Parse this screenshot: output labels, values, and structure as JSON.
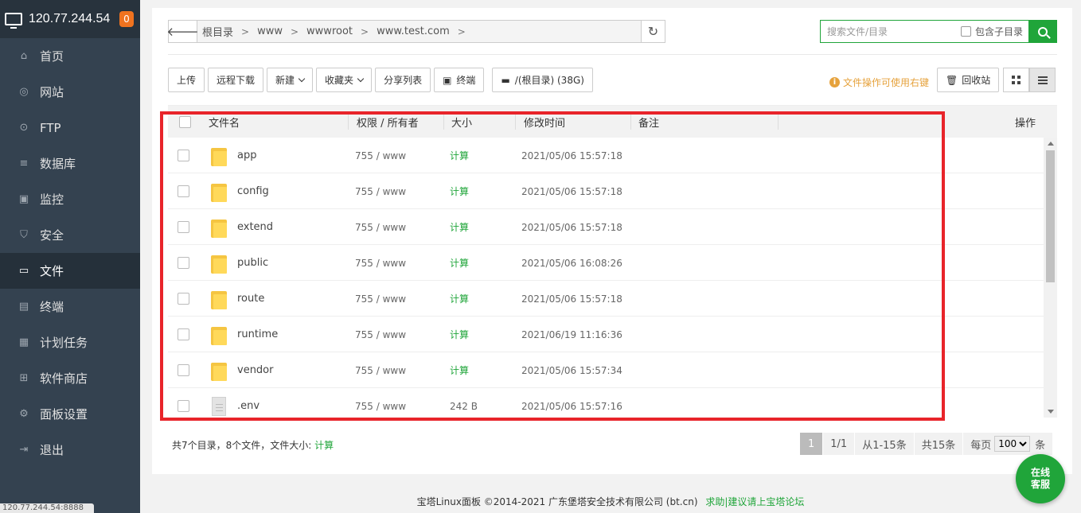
{
  "sidebar": {
    "server_ip": "120.77.244.54",
    "badge_count": "0",
    "items": [
      {
        "label": "首页",
        "icon": "home-icon"
      },
      {
        "label": "网站",
        "icon": "globe-icon"
      },
      {
        "label": "FTP",
        "icon": "ftp-icon"
      },
      {
        "label": "数据库",
        "icon": "database-icon"
      },
      {
        "label": "监控",
        "icon": "monitor-icon"
      },
      {
        "label": "安全",
        "icon": "shield-icon"
      },
      {
        "label": "文件",
        "icon": "folder-icon",
        "active": true
      },
      {
        "label": "终端",
        "icon": "terminal-icon"
      },
      {
        "label": "计划任务",
        "icon": "calendar-icon"
      },
      {
        "label": "软件商店",
        "icon": "apps-icon"
      },
      {
        "label": "面板设置",
        "icon": "gear-icon"
      },
      {
        "label": "退出",
        "icon": "logout-icon"
      }
    ],
    "status_url": "120.77.244.54:8888"
  },
  "path": {
    "crumbs": [
      "根目录",
      "www",
      "wwwroot",
      "www.test.com"
    ]
  },
  "search": {
    "placeholder": "搜索文件/目录",
    "include_sub_label": "包含子目录"
  },
  "toolbar": {
    "upload": "上传",
    "remote_download": "远程下载",
    "new": "新建",
    "favorites": "收藏夹",
    "share_list": "分享列表",
    "terminal": "终端",
    "disk": "/(根目录) (38G)",
    "tip": "文件操作可使用右键",
    "recycle": "回收站"
  },
  "table": {
    "headers": {
      "name": "文件名",
      "perm": "权限 / 所有者",
      "size": "大小",
      "mtime": "修改时间",
      "note": "备注",
      "ops": "操作"
    },
    "rows": [
      {
        "type": "folder",
        "name": "app",
        "perm": "755 / www",
        "size": "计算",
        "mtime": "2021/05/06 15:57:18"
      },
      {
        "type": "folder",
        "name": "config",
        "perm": "755 / www",
        "size": "计算",
        "mtime": "2021/05/06 15:57:18"
      },
      {
        "type": "folder",
        "name": "extend",
        "perm": "755 / www",
        "size": "计算",
        "mtime": "2021/05/06 15:57:18"
      },
      {
        "type": "folder",
        "name": "public",
        "perm": "755 / www",
        "size": "计算",
        "mtime": "2021/05/06 16:08:26"
      },
      {
        "type": "folder",
        "name": "route",
        "perm": "755 / www",
        "size": "计算",
        "mtime": "2021/05/06 15:57:18"
      },
      {
        "type": "folder",
        "name": "runtime",
        "perm": "755 / www",
        "size": "计算",
        "mtime": "2021/06/19 11:16:36"
      },
      {
        "type": "folder",
        "name": "vendor",
        "perm": "755 / www",
        "size": "计算",
        "mtime": "2021/05/06 15:57:34"
      },
      {
        "type": "file",
        "name": ".env",
        "perm": "755 / www",
        "size": "242 B",
        "mtime": "2021/05/06 15:57:16"
      }
    ]
  },
  "summary": {
    "text": "共7个目录，8个文件，文件大小: ",
    "calc_link": "计算"
  },
  "pager": {
    "current": "1",
    "pages": "1/1",
    "range": "从1-15条",
    "total": "共15条",
    "per_page_label": "每页",
    "per_page_value": "100",
    "unit": "条"
  },
  "footer": {
    "copyright": "宝塔Linux面板 ©2014-2021 广东堡塔安全技术有限公司 (bt.cn)",
    "help_link": "求助|建议请上宝塔论坛"
  },
  "chat": {
    "line1": "在线",
    "line2": "客服"
  },
  "colors": {
    "accent": "#20a53a",
    "sidebar": "#344250",
    "highlight": "#e8242a",
    "tip": "#e6a23c"
  }
}
